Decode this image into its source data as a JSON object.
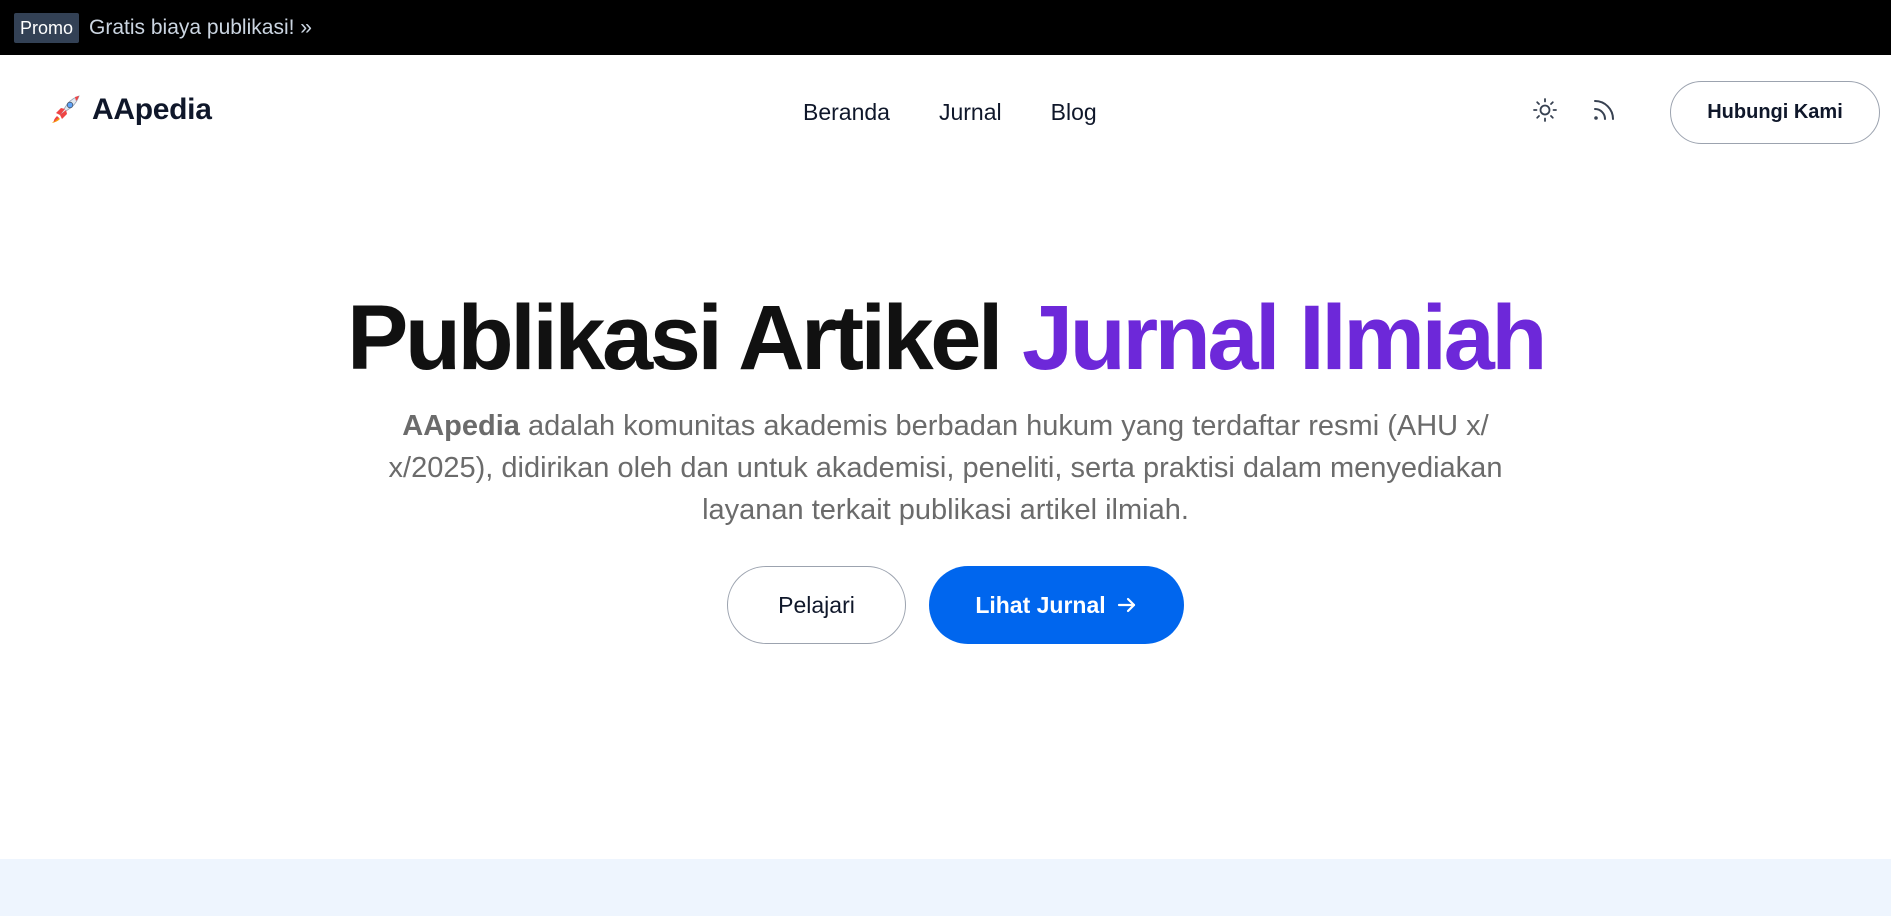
{
  "promo": {
    "badge": "Promo",
    "text": "Gratis biaya publikasi! »"
  },
  "header": {
    "logo_icon": "rocket-icon",
    "logo_text": "AApedia",
    "nav": [
      {
        "label": "Beranda"
      },
      {
        "label": "Jurnal"
      },
      {
        "label": "Blog"
      }
    ],
    "theme_icon": "sun-icon",
    "rss_icon": "rss-icon",
    "contact_label": "Hubungi Kami"
  },
  "hero": {
    "title_main": "Publikasi Artikel ",
    "title_accent": "Jurnal Ilmiah",
    "desc_brand": "AApedia",
    "desc_rest": " adalah komunitas akademis berbadan hukum yang terdaftar resmi (AHU x/ x/2025), didirikan oleh dan untuk akademisi, peneliti, serta praktisi dalam menyediakan layanan terkait publikasi artikel ilmiah.",
    "btn_learn": "Pelajari",
    "btn_journal": "Lihat Jurnal",
    "btn_journal_icon": "arrow-right-icon"
  },
  "colors": {
    "accent": "#6d28d9",
    "primary_button": "#0066ee",
    "promo_bg": "#000000",
    "bottom_band": "#eef5fe"
  }
}
